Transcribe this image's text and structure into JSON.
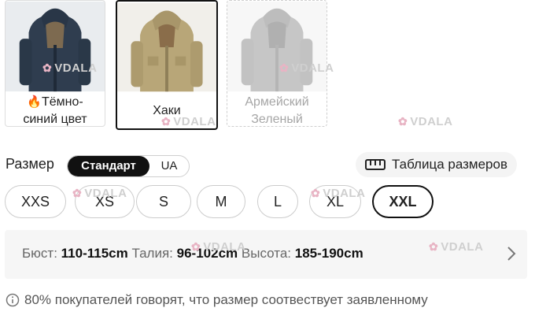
{
  "colors": {
    "swatches": [
      {
        "label_prefix": "🔥",
        "label": "Тёмно-синий цвет",
        "label_line1": "Тёмно-",
        "label_line2": "синий цвет",
        "tone": "#3a4a5c",
        "state": "available"
      },
      {
        "label": "Хаки",
        "tone": "#b9a77a",
        "state": "selected"
      },
      {
        "label": "Армейский Зеленый",
        "label_line1": "Армейский",
        "label_line2": "Зеленый",
        "tone": "#bcbcbc",
        "state": "unavailable"
      }
    ]
  },
  "size": {
    "label": "Размер",
    "standards": [
      "Стандарт",
      "UA"
    ],
    "selected_standard": "Стандарт",
    "size_table_label": "Таблица размеров",
    "options": [
      "XXS",
      "XS",
      "S",
      "M",
      "L",
      "XL",
      "XXL"
    ],
    "selected": "XXL"
  },
  "measurements": {
    "bust_label": "Бюст:",
    "bust_value": "110-115cm",
    "waist_label": "Талия:",
    "waist_value": "96-102cm",
    "height_label": "Высота:",
    "height_value": "185-190cm"
  },
  "fit_note": "80% покупателей говорят, что размер соотвествует заявленному",
  "watermark": "VDALA",
  "icons": {
    "flame": "flame-icon",
    "ruler": "ruler-icon",
    "chevron": "chevron-right-icon",
    "info": "info-icon"
  }
}
